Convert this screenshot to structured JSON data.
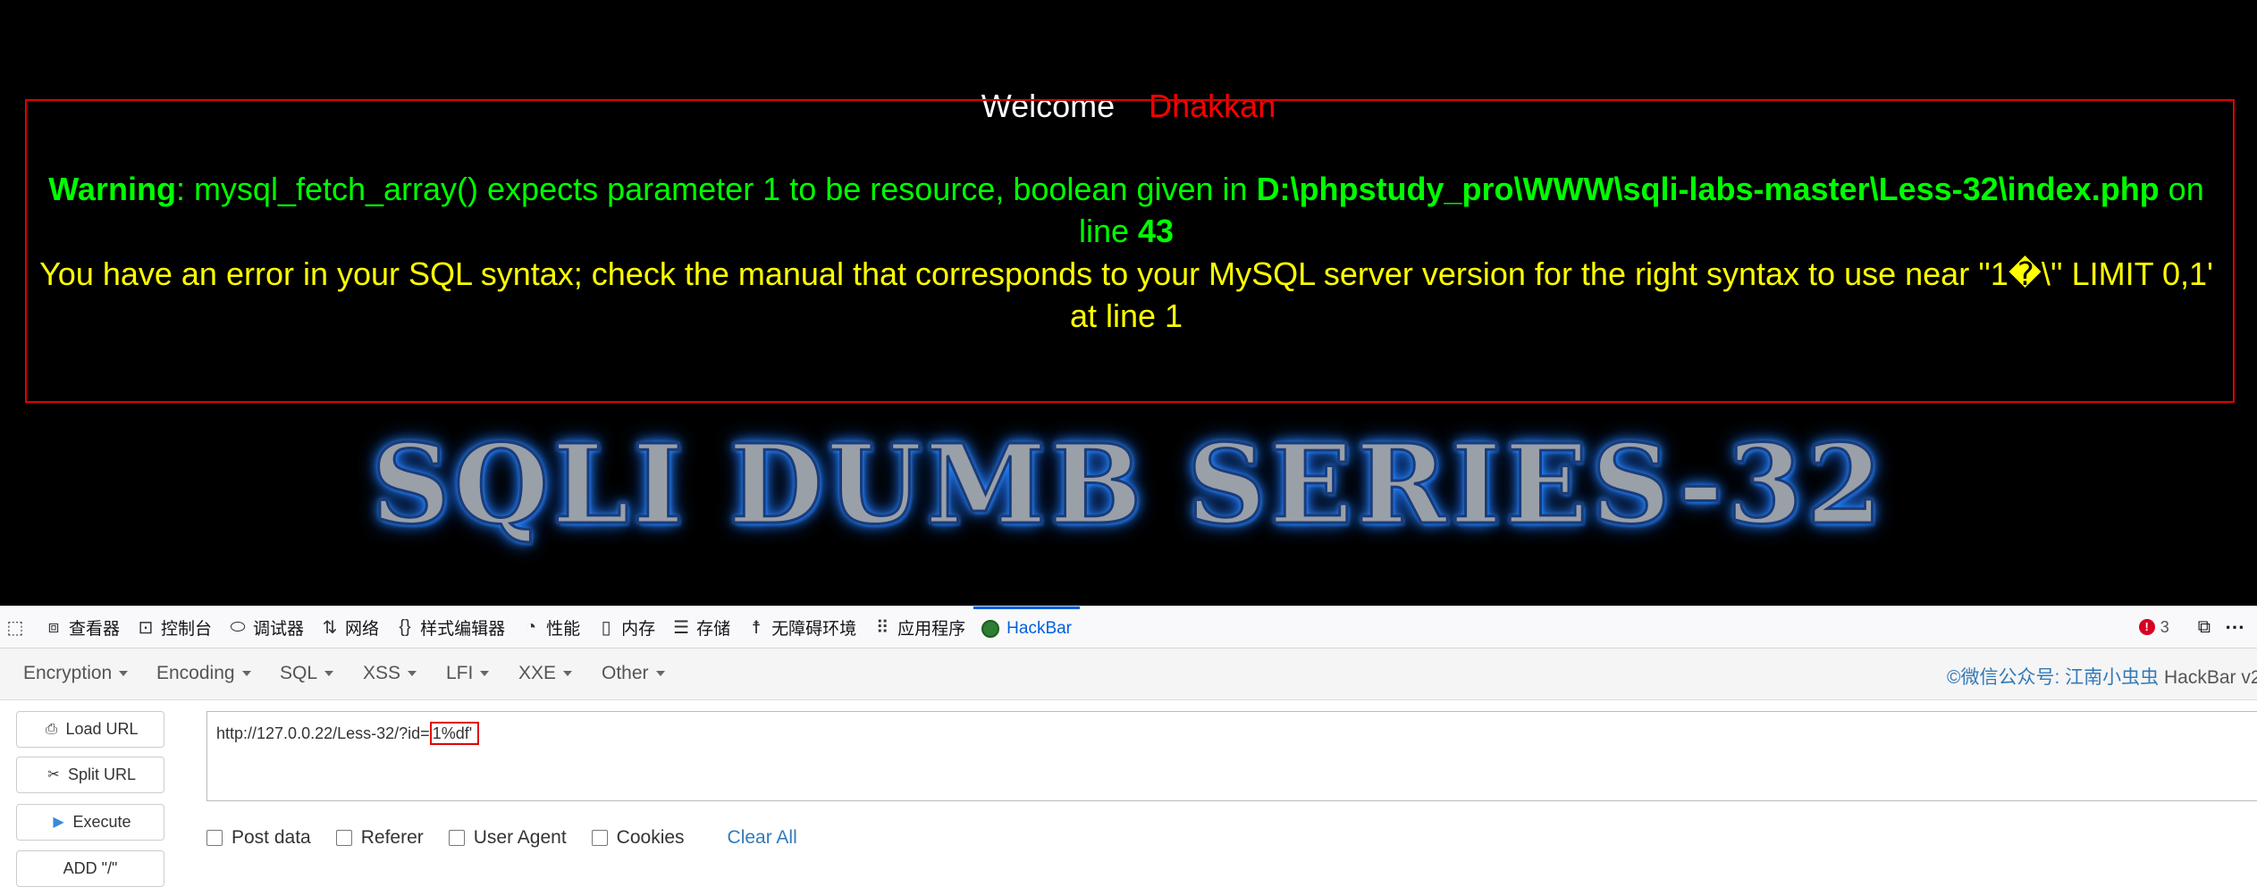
{
  "page": {
    "welcome": "Welcome",
    "user": "Dhakkan",
    "warning_label": "Warning",
    "warning_text": ": mysql_fetch_array() expects parameter 1 to be resource, boolean given in ",
    "warning_path": "D:\\phpstudy_pro\\WWW\\sqli-labs-master\\Less-32\\index.php",
    "warning_online": " on line ",
    "warning_line": "43",
    "sql_error": "You have an error in your SQL syntax; check the manual that corresponds to your MySQL server version for the right syntax to use near ''1�\\'' LIMIT 0,1' at line 1",
    "banner": "SQLI DUMB SERIES-32"
  },
  "devtools": {
    "tabs": [
      {
        "label": "查看器",
        "icon": "inspector-icon"
      },
      {
        "label": "控制台",
        "icon": "console-icon"
      },
      {
        "label": "调试器",
        "icon": "debugger-icon"
      },
      {
        "label": "网络",
        "icon": "network-icon"
      },
      {
        "label": "样式编辑器",
        "icon": "style-editor-icon"
      },
      {
        "label": "性能",
        "icon": "performance-icon"
      },
      {
        "label": "内存",
        "icon": "memory-icon"
      },
      {
        "label": "存储",
        "icon": "storage-icon"
      },
      {
        "label": "无障碍环境",
        "icon": "accessibility-icon"
      },
      {
        "label": "应用程序",
        "icon": "application-icon"
      },
      {
        "label": "HackBar",
        "icon": "hackbar-icon"
      }
    ],
    "error_count": "3"
  },
  "hackbar": {
    "menu": [
      "Encryption",
      "Encoding",
      "SQL",
      "XSS",
      "LFI",
      "XXE",
      "Other"
    ],
    "credit": "©微信公众号: 江南小虫虫",
    "credit_tail": " HackBar v2",
    "buttons": {
      "load_url": "Load URL",
      "split_url": "Split URL",
      "execute": "Execute",
      "add_slash": "ADD \"/\""
    },
    "url_prefix": "http://127.0.0.22/Less-32/?id=",
    "url_highlight": "1%df'",
    "options": [
      "Post data",
      "Referer",
      "User Agent",
      "Cookies"
    ],
    "clear_all": "Clear All"
  }
}
